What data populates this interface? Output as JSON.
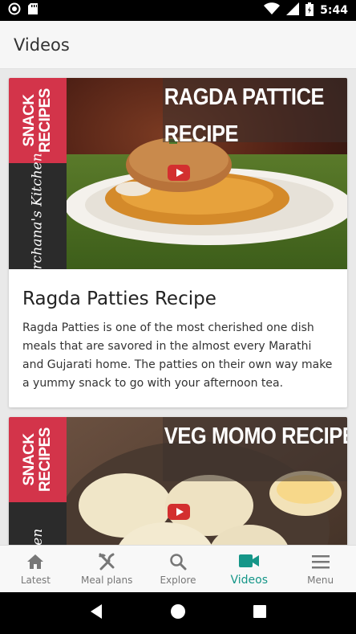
{
  "status_bar": {
    "time": "5:44",
    "icons": [
      "ring-icon",
      "sd-card-icon",
      "wifi-icon",
      "signal-icon",
      "battery-icon"
    ]
  },
  "app_bar": {
    "title": "Videos"
  },
  "videos": [
    {
      "thumb_overlay_line1": "RAGDA PATTICE",
      "thumb_overlay_line2": "RECIPE",
      "band_top": "SNACK\nRECIPES",
      "band_bottom": "Archana's Kitchen",
      "title": "Ragda Patties Recipe",
      "description": "Ragda Patties is one of the most cherished one dish meals that are savored in the almost every Marathi and Gujarati home. The patties on their own way make a yummy snack to go with your afternoon tea."
    },
    {
      "thumb_overlay_line1": "VEG MOMO RECIPE",
      "band_top": "SNACK\nRECIPES",
      "band_bottom": "Kitchen"
    }
  ],
  "bottom_nav": {
    "items": [
      {
        "label": "Latest",
        "icon": "home-icon"
      },
      {
        "label": "Meal plans",
        "icon": "fork-knife-icon"
      },
      {
        "label": "Explore",
        "icon": "search-icon"
      },
      {
        "label": "Videos",
        "icon": "video-camera-icon"
      },
      {
        "label": "Menu",
        "icon": "hamburger-menu-icon"
      }
    ],
    "active": "Videos"
  },
  "colors": {
    "accent": "#159688",
    "band_red": "#d3344a",
    "band_dark": "#2b2b2b",
    "youtube_red": "#d32f2f"
  }
}
